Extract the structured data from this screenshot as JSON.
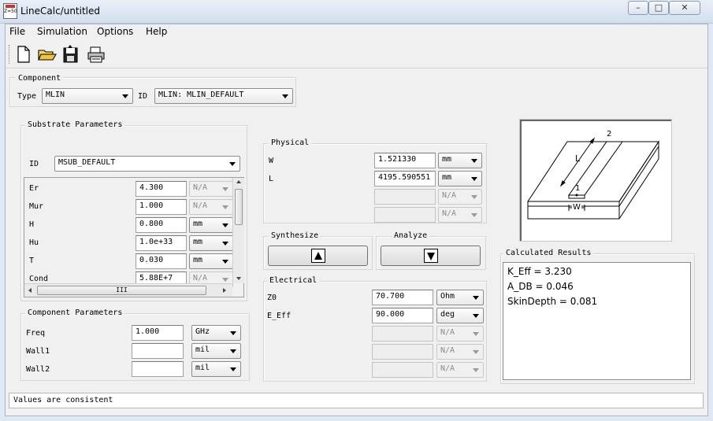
{
  "window": {
    "title": "LineCalc/untitled",
    "icon_text": "Z=50",
    "controls": {
      "minimize": "–",
      "maximize": "□",
      "close": "✕"
    }
  },
  "menu": [
    "File",
    "Simulation",
    "Options",
    "Help"
  ],
  "toolbar": {
    "icons": [
      "new-file-icon",
      "open-folder-icon",
      "save-disk-icon",
      "print-icon"
    ]
  },
  "component": {
    "title": "Component",
    "type_label": "Type",
    "type_value": "MLIN",
    "id_label": "ID",
    "id_value": "MLIN: MLIN_DEFAULT"
  },
  "substrate": {
    "title": "Substrate Parameters",
    "id_label": "ID",
    "id_value": "MSUB_DEFAULT",
    "params": [
      {
        "name": "Er",
        "value": "4.300",
        "unit": "N/A",
        "enabled": false
      },
      {
        "name": "Mur",
        "value": "1.000",
        "unit": "N/A",
        "enabled": false
      },
      {
        "name": "H",
        "value": "0.800",
        "unit": "mm",
        "enabled": true
      },
      {
        "name": "Hu",
        "value": "1.0e+33",
        "unit": "mm",
        "enabled": true
      },
      {
        "name": "T",
        "value": "0.030",
        "unit": "mm",
        "enabled": true
      },
      {
        "name": "Cond",
        "value": "5.88E+7",
        "unit": "N/A",
        "enabled": false
      }
    ],
    "hscroll_grip": "III"
  },
  "component_params": {
    "title": "Component Parameters",
    "params": [
      {
        "name": "Freq",
        "value": "1.000",
        "unit": "GHz"
      },
      {
        "name": "Wall1",
        "value": "",
        "unit": "mil"
      },
      {
        "name": "Wall2",
        "value": "",
        "unit": "mil"
      }
    ]
  },
  "physical": {
    "title": "Physical",
    "params": [
      {
        "name": "W",
        "value": "1.521330",
        "unit": "mm",
        "enabled": true
      },
      {
        "name": "L",
        "value": "4195.590551",
        "unit": "mm",
        "enabled": true
      },
      {
        "name": "",
        "value": "",
        "unit": "N/A",
        "enabled": false
      },
      {
        "name": "",
        "value": "",
        "unit": "N/A",
        "enabled": false
      }
    ]
  },
  "synthesize": {
    "title": "Synthesize"
  },
  "analyze": {
    "title": "Analyze"
  },
  "electrical": {
    "title": "Electrical",
    "params": [
      {
        "name": "Z0",
        "value": "70.700",
        "unit": "Ohm",
        "enabled": true
      },
      {
        "name": "E_Eff",
        "value": "90.000",
        "unit": "deg",
        "enabled": true
      },
      {
        "name": "",
        "value": "",
        "unit": "N/A",
        "enabled": false
      },
      {
        "name": "",
        "value": "",
        "unit": "N/A",
        "enabled": false
      },
      {
        "name": "",
        "value": "",
        "unit": "N/A",
        "enabled": false
      }
    ]
  },
  "diagram": {
    "label_length": "L",
    "label_width": "W",
    "port1": "1",
    "port2": "2"
  },
  "results": {
    "title": "Calculated Results",
    "lines": [
      "K_Eff = 3.230",
      "A_DB = 0.046",
      "SkinDepth = 0.081"
    ]
  },
  "status": "Values are consistent"
}
